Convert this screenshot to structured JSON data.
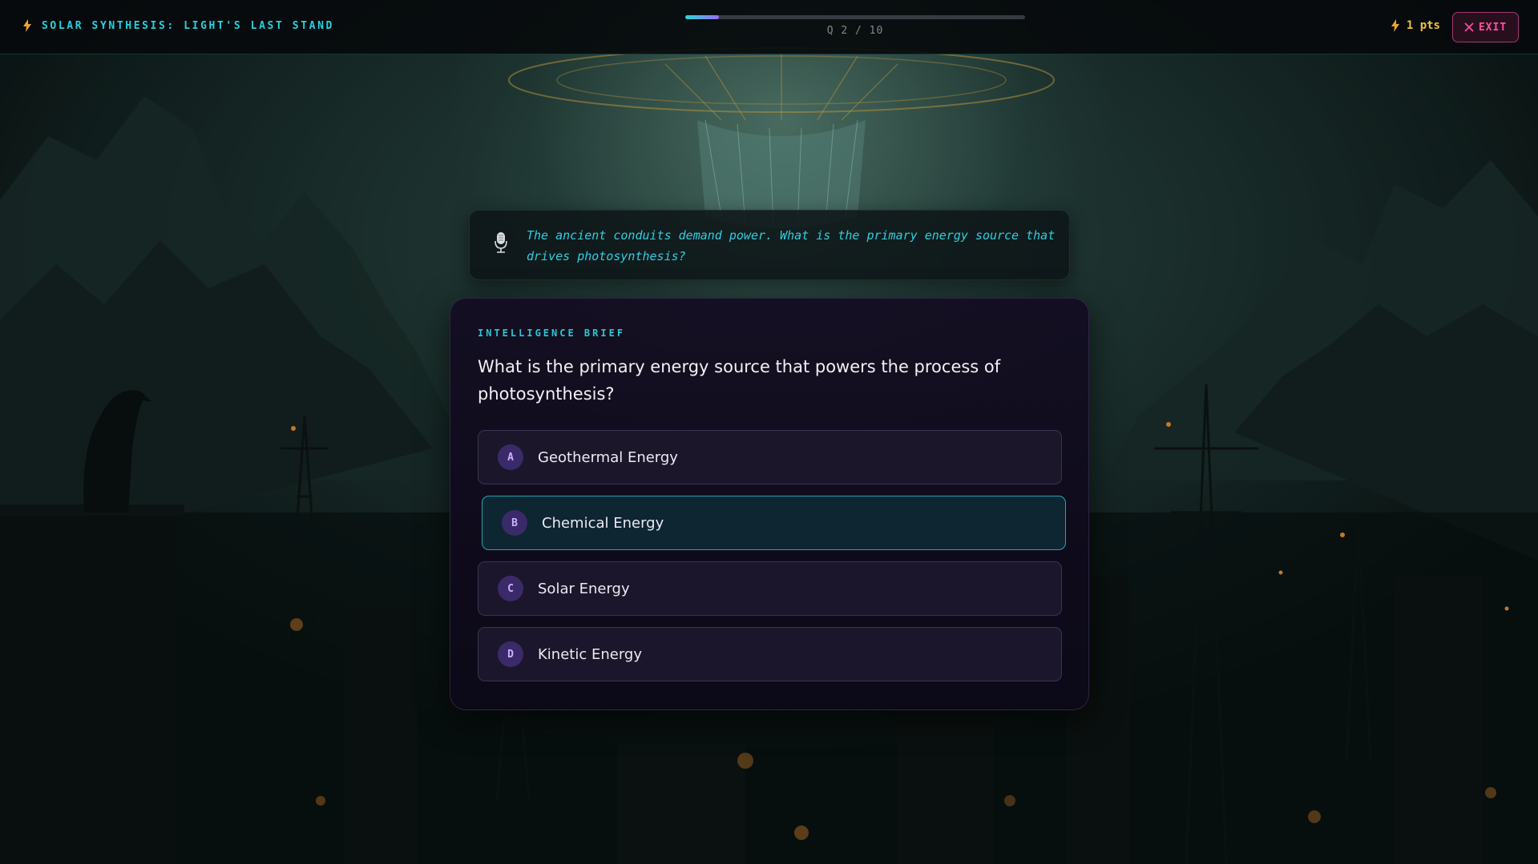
{
  "header": {
    "title": "SOLAR SYNTHESIS: LIGHT'S LAST STAND",
    "title_icon": "lightning-bolt-icon",
    "progress_label": "Q 2 / 10",
    "progress_fraction": 0.1,
    "score": "1 pts",
    "score_icon": "lightning-bolt-icon",
    "exit_label": "EXIT",
    "exit_icon": "close-x-icon"
  },
  "narrator": {
    "icon": "microphone-icon",
    "text": "The ancient conduits demand power. What is the primary energy source that drives photosynthesis?"
  },
  "question": {
    "section_label": "INTELLIGENCE BRIEF",
    "text": "What is the primary energy source that powers the process of photosynthesis?",
    "options": [
      {
        "letter": "A",
        "label": "Geothermal Energy",
        "selected": false
      },
      {
        "letter": "B",
        "label": "Chemical Energy",
        "selected": true
      },
      {
        "letter": "C",
        "label": "Solar Energy",
        "selected": false
      },
      {
        "letter": "D",
        "label": "Kinetic Energy",
        "selected": false
      }
    ]
  },
  "colors": {
    "accent_cyan": "#25d3e0",
    "score_gold": "#f2c13a",
    "exit_pink": "#ff4fa0",
    "option_letter_bg": "#3b2a6a",
    "selected_border": "#1fa6b3"
  }
}
